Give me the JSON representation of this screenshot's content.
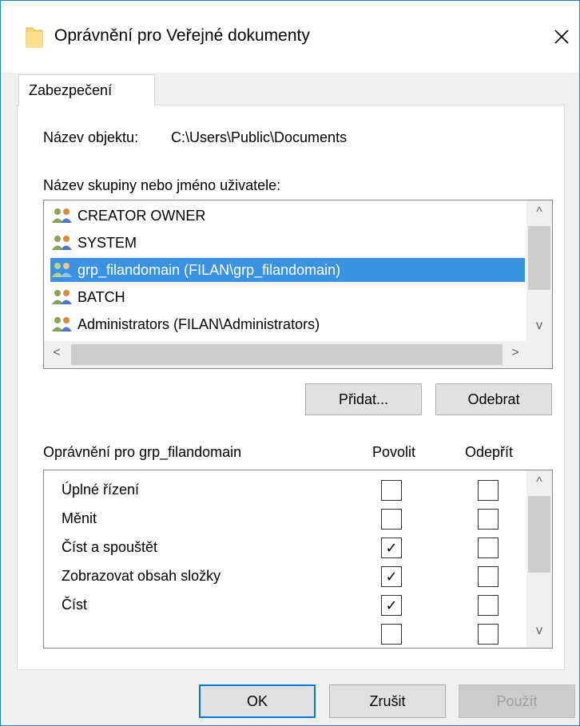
{
  "window": {
    "title": "Oprávnění pro Veřejné dokumenty",
    "close_glyph": "✕"
  },
  "tabs": [
    {
      "label": "Zabezpečení",
      "active": true
    }
  ],
  "object": {
    "label": "Název objektu:",
    "value": "C:\\Users\\Public\\Documents"
  },
  "groups": {
    "label": "Název skupiny nebo jméno uživatele:",
    "items": [
      {
        "label": "CREATOR OWNER",
        "icon": "users-icon",
        "selected": false
      },
      {
        "label": "SYSTEM",
        "icon": "users-icon",
        "selected": false
      },
      {
        "label": "grp_filandomain (FILAN\\grp_filandomain)",
        "icon": "users-icon",
        "selected": true
      },
      {
        "label": "BATCH",
        "icon": "users-icon",
        "selected": false
      },
      {
        "label": "Administrators (FILAN\\Administrators)",
        "icon": "users-icon",
        "selected": false
      }
    ],
    "scroll_up": "^",
    "scroll_down": "v",
    "scroll_left": "<",
    "scroll_right": ">"
  },
  "group_buttons": {
    "add": "Přidat...",
    "remove": "Odebrat"
  },
  "permissions": {
    "header": "Oprávnění pro grp_filandomain",
    "allow_header": "Povolit",
    "deny_header": "Odepřít",
    "check_glyph": "✓",
    "rows": [
      {
        "label": "Úplné řízení",
        "allow": false,
        "deny": false
      },
      {
        "label": "Měnit",
        "allow": false,
        "deny": false
      },
      {
        "label": "Číst a spouštět",
        "allow": true,
        "deny": false
      },
      {
        "label": "Zobrazovat obsah složky",
        "allow": true,
        "deny": false
      },
      {
        "label": "Číst",
        "allow": true,
        "deny": false
      }
    ]
  },
  "dialog_buttons": {
    "ok": "OK",
    "cancel": "Zrušit",
    "apply": "Použít"
  },
  "colors": {
    "selection": "#3a92e3",
    "accent": "#0078d7",
    "folder": "#f8d775"
  }
}
